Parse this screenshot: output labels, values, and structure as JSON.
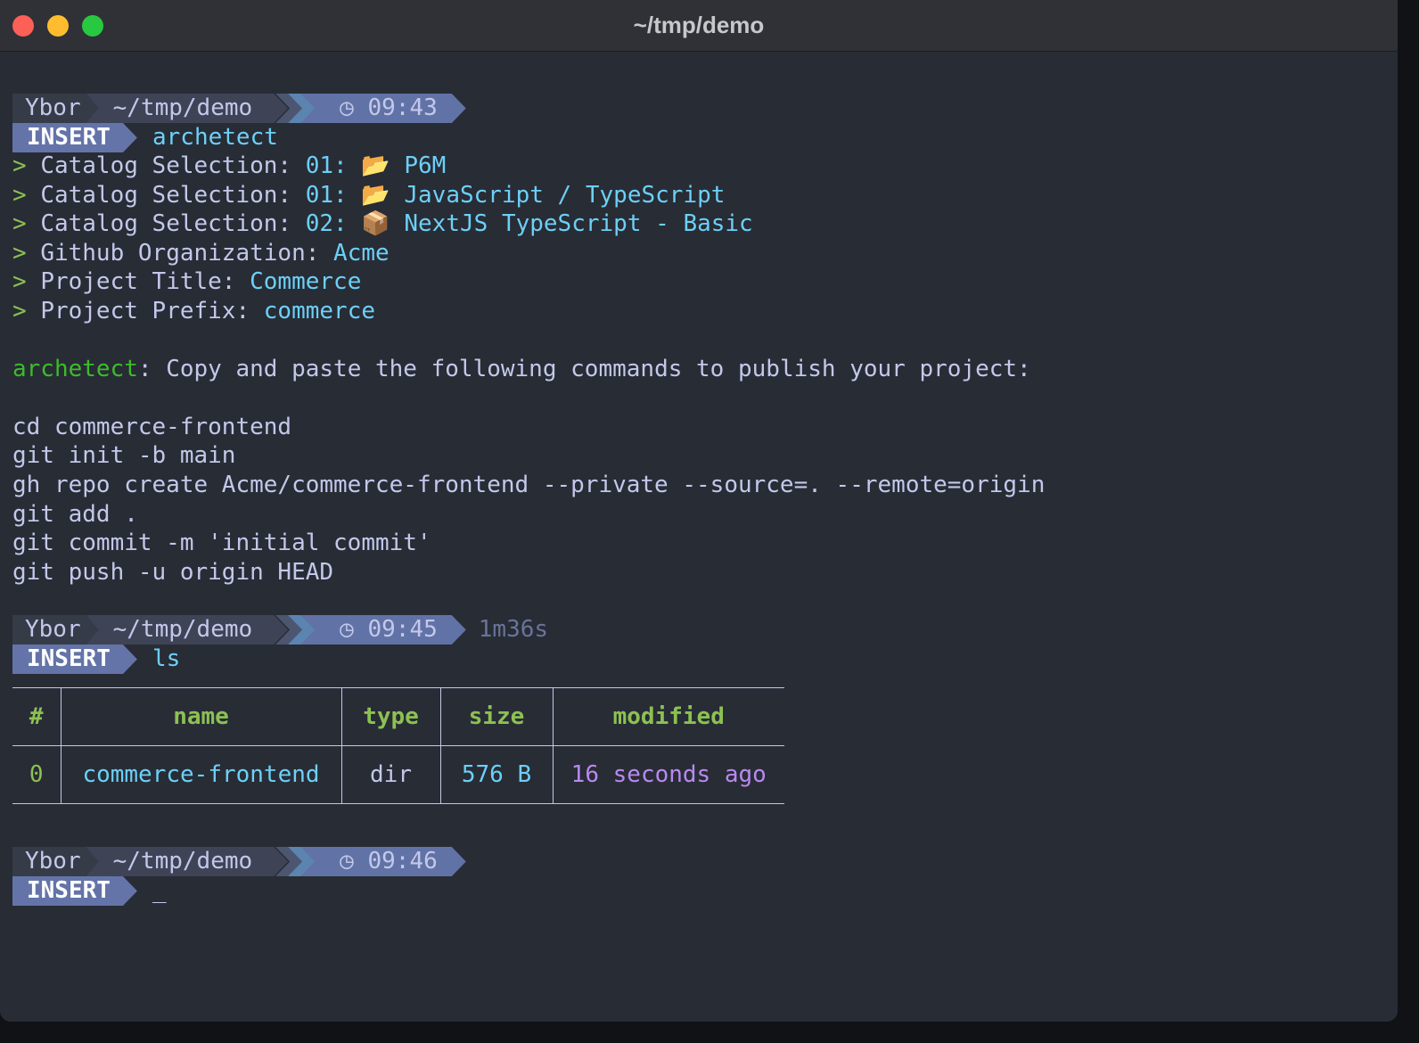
{
  "window": {
    "title": "~/tmp/demo"
  },
  "prompts": [
    {
      "user": "Ybor",
      "path": "~/tmp/demo",
      "time": "09:43",
      "duration": null,
      "mode": "INSERT",
      "command": "archetect"
    },
    {
      "user": "Ybor",
      "path": "~/tmp/demo",
      "time": "09:45",
      "duration": "1m36s",
      "mode": "INSERT",
      "command": "ls"
    },
    {
      "user": "Ybor",
      "path": "~/tmp/demo",
      "time": "09:46",
      "duration": null,
      "mode": "INSERT",
      "command": "_"
    }
  ],
  "answers": [
    {
      "label": "Catalog Selection:",
      "value": "01: 📂 P6M"
    },
    {
      "label": "Catalog Selection:",
      "value": "01: 📂 JavaScript / TypeScript"
    },
    {
      "label": "Catalog Selection:",
      "value": "02: 📦 NextJS TypeScript - Basic"
    },
    {
      "label": "Github Organization:",
      "value": "Acme"
    },
    {
      "label": "Project Title:",
      "value": "Commerce"
    },
    {
      "label": "Project Prefix:",
      "value": "commerce"
    }
  ],
  "message": {
    "app": "archetect",
    "text": ": Copy and paste the following commands to publish your project:"
  },
  "commands": [
    "cd commerce-frontend",
    "git init -b main",
    "gh repo create Acme/commerce-frontend --private --source=. --remote=origin",
    "git add .",
    "git commit -m 'initial commit'",
    "git push -u origin HEAD"
  ],
  "table": {
    "headers": [
      "#",
      "name",
      "type",
      "size",
      "modified"
    ],
    "rows": [
      [
        "0",
        "commerce-frontend",
        "dir",
        "576 B",
        "16 seconds ago"
      ]
    ]
  },
  "colors": {
    "background": "#282c35",
    "accent": "#6474a8",
    "cyan": "#6cd0f7",
    "green": "#8cc152"
  }
}
